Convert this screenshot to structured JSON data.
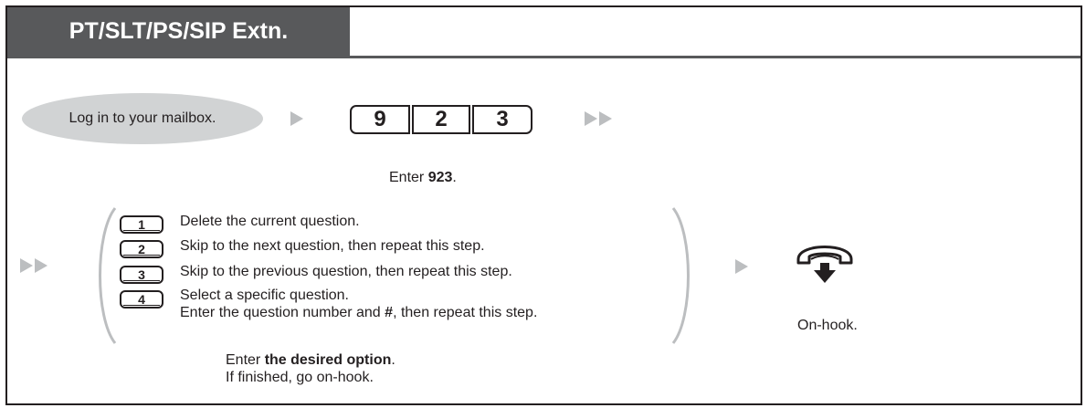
{
  "header": {
    "title": "PT/SLT/PS/SIP Extn."
  },
  "step1": {
    "pill_label": "Log in to your mailbox.",
    "keys": [
      "9",
      "2",
      "3"
    ],
    "caption_prefix": "Enter ",
    "caption_bold": "923",
    "caption_suffix": "."
  },
  "step2": {
    "options": [
      {
        "key": "1",
        "text": "Delete the current question."
      },
      {
        "key": "2",
        "text": "Skip to the next question, then repeat this step."
      },
      {
        "key": "3",
        "text": "Skip to the previous question, then repeat this step."
      },
      {
        "key": "4",
        "text": "Select a specific question.",
        "line2_prefix": "Enter the question number and ",
        "line2_bold": "#",
        "line2_suffix": ", then repeat this step."
      }
    ],
    "caption_prefix": "Enter ",
    "caption_bold": "the desired option",
    "caption_suffix": ".",
    "caption_line2": "If finished, go on-hook."
  },
  "step3": {
    "label": "On-hook.",
    "icon": "on-hook-handset-icon"
  },
  "colors": {
    "header_bg": "#58595b",
    "pill_bg": "#d1d3d4",
    "arrow": "#bcbec0",
    "text": "#231f20"
  }
}
